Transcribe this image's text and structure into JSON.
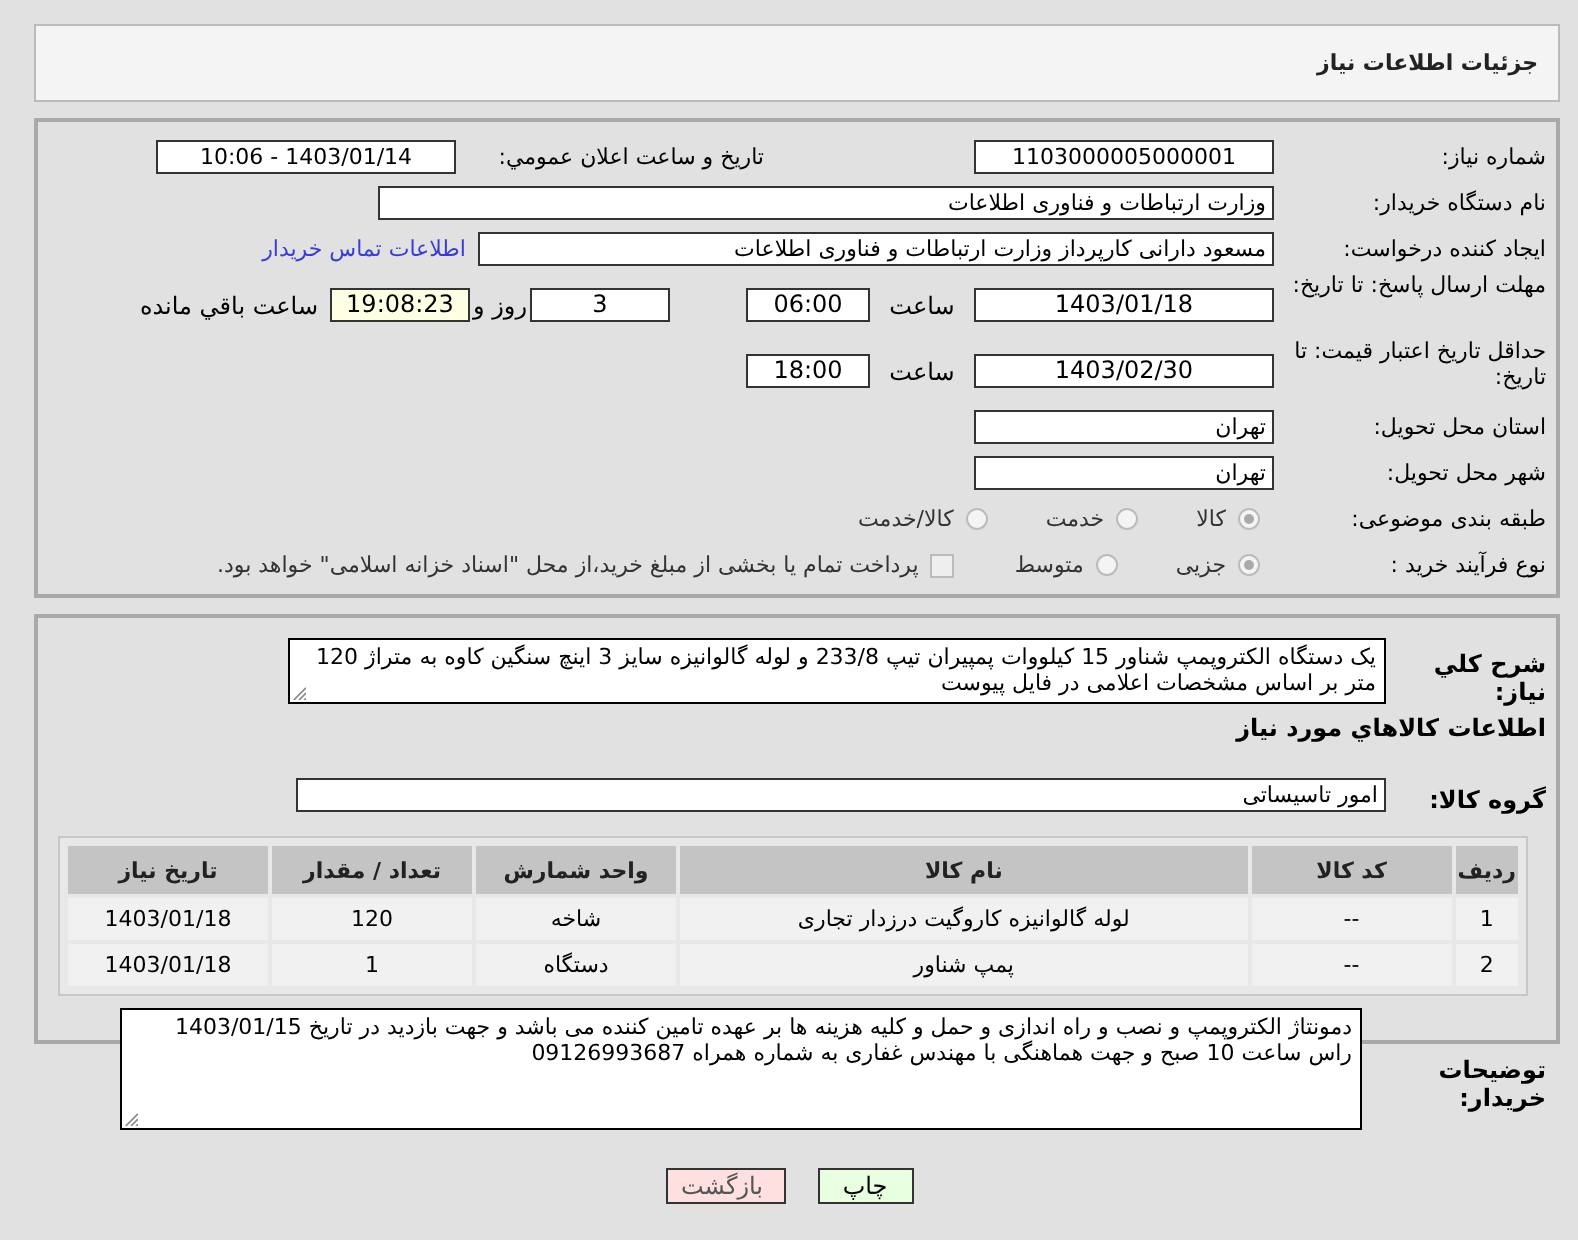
{
  "page_title": "جزئیات اطلاعات نیاز",
  "need_number": {
    "label": "شماره نیاز:",
    "value": "1103000005000001"
  },
  "announce": {
    "label": "تاريخ و ساعت اعلان عمومي:",
    "value": "1403/01/14 - 10:06"
  },
  "buyer_org": {
    "label": "نام دستگاه خریدار:",
    "value": "وزارت ارتباطات و فناوری اطلاعات"
  },
  "requester": {
    "label": "ایجاد کننده درخواست:",
    "value": "مسعود دارانی کارپرداز وزارت ارتباطات و فناوری اطلاعات",
    "link": "اطلاعات تماس خریدار"
  },
  "reply_deadline": {
    "label": "مهلت ارسال پاسخ: تا تاریخ:",
    "date": "1403/01/18",
    "time_label": "ساعت",
    "time": "06:00",
    "days": "3",
    "days_label": "روز و",
    "remaining": "19:08:23",
    "remaining_label": "ساعت باقي مانده"
  },
  "price_validity": {
    "label": "حداقل تاریخ اعتبار قیمت: تا تاریخ:",
    "date": "1403/02/30",
    "time_label": "ساعت",
    "time": "18:00"
  },
  "province": {
    "label": "استان محل تحویل:",
    "value": "تهران"
  },
  "city": {
    "label": "شهر محل تحویل:",
    "value": "تهران"
  },
  "category": {
    "label": "طبقه بندی موضوعی:",
    "options": [
      {
        "label": "کالا",
        "selected": true
      },
      {
        "label": "خدمت",
        "selected": false
      },
      {
        "label": "کالا/خدمت",
        "selected": false
      }
    ]
  },
  "process": {
    "label": "نوع فرآیند خرید :",
    "options": [
      {
        "label": "جزیی",
        "selected": true
      },
      {
        "label": "متوسط",
        "selected": false
      }
    ],
    "treasury": {
      "label": "پرداخت تمام یا بخشی از مبلغ خرید،از محل \"اسناد خزانه اسلامی\" خواهد بود.",
      "checked": false
    }
  },
  "description": {
    "label": "شرح کلي نياز:",
    "value": "یک دستگاه الکتروپمپ شناور 15 کیلووات پمپیران تیپ 233/8 و لوله گالوانیزه سایز 3 اینچ سنگین کاوه  به متراژ 120 متر بر اساس مشخصات اعلامی در فایل پیوست"
  },
  "goods_heading": "اطلاعات کالاهاي مورد نياز",
  "goods_group": {
    "label": "گروه کالا:",
    "value": "امور تاسیساتی"
  },
  "table": {
    "columns": [
      "ردیف",
      "کد کالا",
      "نام کالا",
      "واحد شمارش",
      "تعداد / مقدار",
      "تاریخ نیاز"
    ],
    "rows": [
      [
        "1",
        "--",
        "لوله گالوانیزه کاروگیت درزدار تجاری",
        "شاخه",
        "120",
        "1403/01/18"
      ],
      [
        "2",
        "--",
        "پمپ شناور",
        "دستگاه",
        "1",
        "1403/01/18"
      ]
    ]
  },
  "buyer_notes": {
    "label": "توضیحات خریدار:",
    "value": "دمونتاژ الکتروپمپ و نصب و راه اندازی و حمل و کلیه هزینه ها بر عهده تامین کننده می باشد و جهت بازدید در تاریخ 1403/01/15 راس ساعت 10 صبح و جهت هماهنگی با مهندس غفاری به شماره همراه 09126993687"
  },
  "buttons": {
    "print": "چاپ",
    "back": "بازگشت"
  }
}
